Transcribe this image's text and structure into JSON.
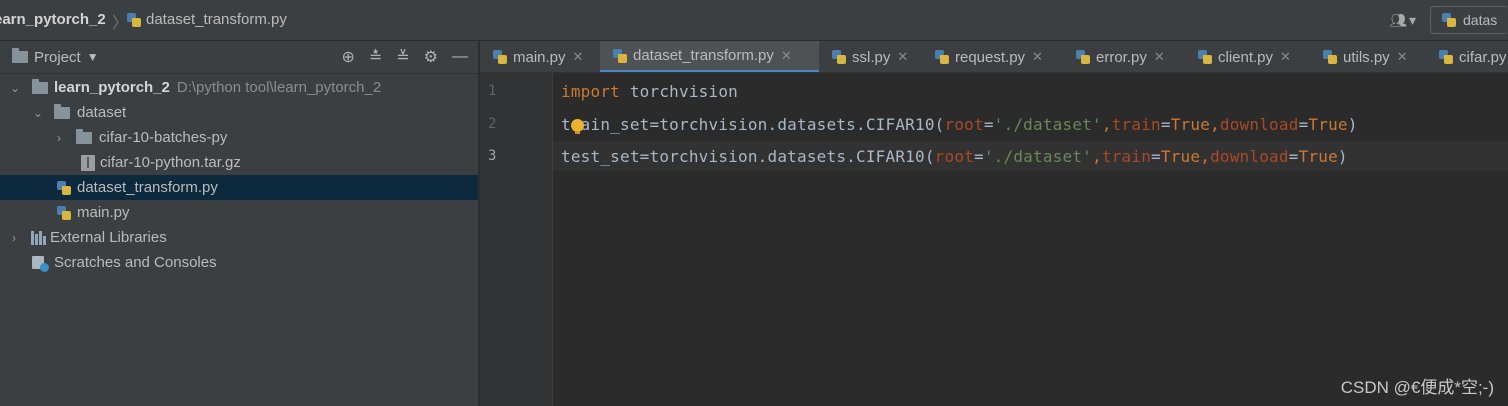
{
  "breadcrumb": {
    "project": "earn_pytorch_2",
    "file": "dataset_transform.py"
  },
  "run_config": {
    "label": "datas"
  },
  "sidebar": {
    "title": "Project",
    "tree": {
      "root": {
        "name": "learn_pytorch_2",
        "path": "D:\\python tool\\learn_pytorch_2"
      },
      "dataset": "dataset",
      "batches": "cifar-10-batches-py",
      "targz": "cifar-10-python.tar.gz",
      "transform": "dataset_transform.py",
      "main": "main.py",
      "external": "External Libraries",
      "scratches": "Scratches and Consoles"
    }
  },
  "tabs": [
    {
      "label": "main.py"
    },
    {
      "label": "dataset_transform.py"
    },
    {
      "label": "ssl.py"
    },
    {
      "label": "request.py"
    },
    {
      "label": "error.py"
    },
    {
      "label": "client.py"
    },
    {
      "label": "utils.py"
    },
    {
      "label": "cifar.py"
    }
  ],
  "editor": {
    "line_numbers": [
      "1",
      "2",
      "3"
    ],
    "line1": {
      "kw": "import",
      "rest": " torchvision"
    },
    "line2": {
      "a": "train_set=torchvision.datasets.CIFAR10(",
      "p1": "root",
      "eq1": "=",
      "s1": "'./dataset'",
      "c1": ",",
      "p2": "train",
      "eq2": "=",
      "k2": "True",
      "c2": ",",
      "p3": "download",
      "eq3": "=",
      "k3": "True",
      "end": ")"
    },
    "line3": {
      "a": "test_set=torchvision.datasets.CIFAR10(",
      "p1": "root",
      "eq1": "=",
      "s1": "'./dataset'",
      "c1": ",",
      "p2": "train",
      "eq2": "=",
      "k2": "True",
      "c2": ",",
      "p3": "download",
      "eq3": "=",
      "k3": "True",
      "end": ")"
    }
  },
  "watermark": "CSDN @€便成*空;-)"
}
